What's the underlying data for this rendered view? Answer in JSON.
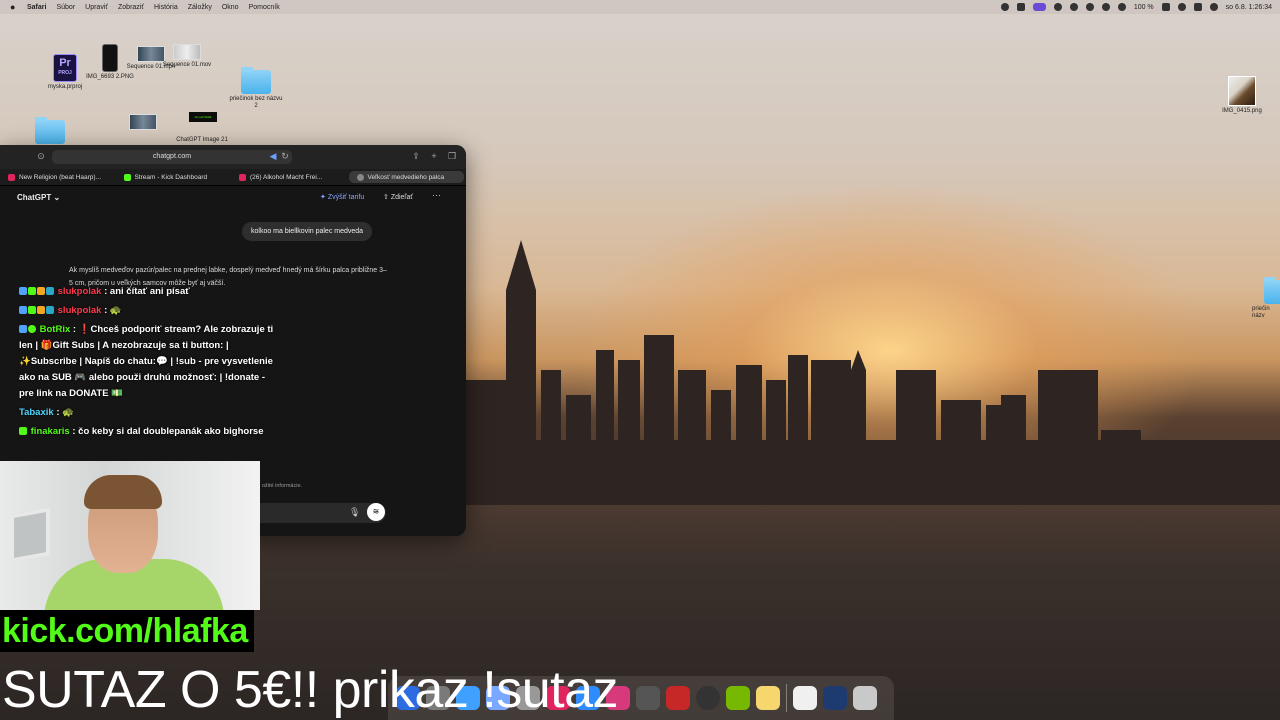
{
  "menubar": {
    "app": "Safari",
    "items": [
      "Súbor",
      "Upraviť",
      "Zobraziť",
      "História",
      "Záložky",
      "Okno",
      "Pomocník"
    ],
    "battery": "100 %",
    "datetime": "so 6.8.  1:26:34"
  },
  "desktop": {
    "icons": [
      {
        "label": "myska.prproj",
        "icon": "premiere-project-icon"
      },
      {
        "label": "IMG_6693 2.PNG",
        "icon": "image-file-icon"
      },
      {
        "label": "Sequence 01.mp4",
        "icon": "video-file-icon"
      },
      {
        "label": "Sequence 01.mov",
        "icon": "video-file-icon"
      },
      {
        "label": "priečinok bez názvu 2",
        "icon": "folder-icon"
      },
      {
        "label": "ChatGPT Image 21",
        "icon": "image-file-icon"
      },
      {
        "label": "IMG_0415.png",
        "icon": "image-file-icon"
      },
      {
        "label": "priečin názv",
        "icon": "folder-icon"
      }
    ],
    "small_thumb_text": "ck.com/hlafk"
  },
  "safari": {
    "url": "chatgpt.com",
    "tabs": [
      {
        "label": "New Religion (beat Haarp)...",
        "color": "#e0245e"
      },
      {
        "label": "Stream - Kick Dashboard",
        "color": "#52fb18"
      },
      {
        "label": "(26) Alkohol Macht Frei...",
        "color": "#e0245e"
      },
      {
        "label": "Veľkosť medvedieho palca",
        "color": "#888888",
        "active": true
      }
    ],
    "chatgpt": {
      "title": "ChatGPT",
      "upgrade": "Zvýšiť tarifu",
      "share": "Zdieľať",
      "user_message": "kolkoo ma biellkovin palec medveda",
      "reply": "Ak myslíš medveďov pazúr/palec na prednej labke, dospelý medveď hnedý má šírku palca približne 3–5 cm, pričom u veľkých samcov môže byť aj väčší.",
      "disclaimer": "ožité informácie."
    }
  },
  "stream_chat": [
    {
      "user": "slukpolak",
      "user_color": "#ff3b4e",
      "text": "ani čítať ani písať"
    },
    {
      "user": "slukpolak",
      "user_color": "#ff3b4e",
      "text": "🐢"
    },
    {
      "user": "BotRix",
      "user_color": "#52fb18",
      "text": "❗Chceš podporiť stream? Ale zobrazuje ti len | 🎁Gift Subs | A nezobrazuje sa ti button: | ✨Subscribe | Napíš do chatu:💬 | !sub - pre vysvetlenie ako na SUB 🎮 alebo použi druhú možnosť: | !donate - pre link na DONATE 💵"
    },
    {
      "user": "Tabaxik",
      "user_color": "#4fd6ff",
      "text": "🐢"
    },
    {
      "user": "finakaris",
      "user_color": "#52fb18",
      "text": "čo keby si dal doublepanák ako bighorse"
    }
  ],
  "overlay": {
    "kick_url": "kick.com/hlafka",
    "contest": "SUTAZ O 5€!! prikaz !sutaz"
  },
  "colors": {
    "kick_green": "#52fb18",
    "chatgpt_accent": "#8aa6ff"
  }
}
